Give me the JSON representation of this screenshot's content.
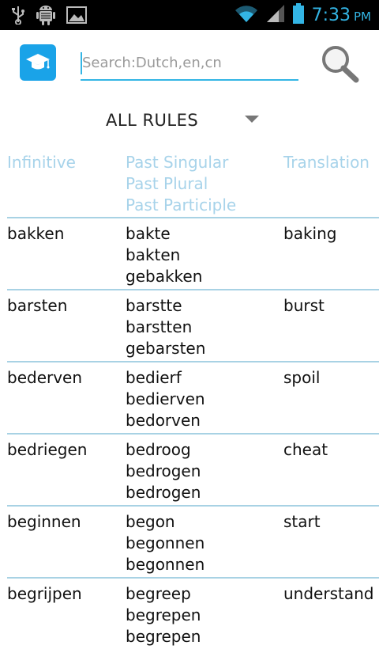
{
  "status_bar": {
    "time": "7:33",
    "ampm": "PM",
    "icons": [
      "usb-icon",
      "android-debug-icon",
      "image-icon",
      "wifi-icon",
      "signal-icon",
      "battery-icon"
    ]
  },
  "header": {
    "app_icon": "graduation-cap-icon",
    "search_placeholder": "Search:Dutch,en,cn",
    "search_value": "",
    "search_button_icon": "search-icon"
  },
  "filter": {
    "selected": "ALL RULES"
  },
  "table": {
    "headers": {
      "infinitive": "Infinitive",
      "past_singular": "Past Singular",
      "past_plural": "Past Plural",
      "past_participle": "Past Participle",
      "translation": "Translation"
    },
    "rows": [
      {
        "infinitive": "bakken",
        "past_singular": "bakte",
        "past_plural": "bakten",
        "past_participle": "gebakken",
        "translation": "baking"
      },
      {
        "infinitive": "barsten",
        "past_singular": "barstte",
        "past_plural": "barstten",
        "past_participle": "gebarsten",
        "translation": "burst"
      },
      {
        "infinitive": "bederven",
        "past_singular": "bedierf",
        "past_plural": "bedierven",
        "past_participle": "bedorven",
        "translation": "spoil"
      },
      {
        "infinitive": "bedriegen",
        "past_singular": "bedroog",
        "past_plural": "bedrogen",
        "past_participle": "bedrogen",
        "translation": "cheat"
      },
      {
        "infinitive": "beginnen",
        "past_singular": "begon",
        "past_plural": "begonnen",
        "past_participle": "begonnen",
        "translation": "start"
      },
      {
        "infinitive": "begrijpen",
        "past_singular": "begreep",
        "past_plural": "begrepen",
        "past_participle": "begrepen",
        "translation": "understand"
      }
    ]
  },
  "colors": {
    "accent": "#33b5e5",
    "header_text": "#a7d3ea",
    "divider": "#a8d2e4",
    "app_icon_bg": "#1aa3e8"
  }
}
